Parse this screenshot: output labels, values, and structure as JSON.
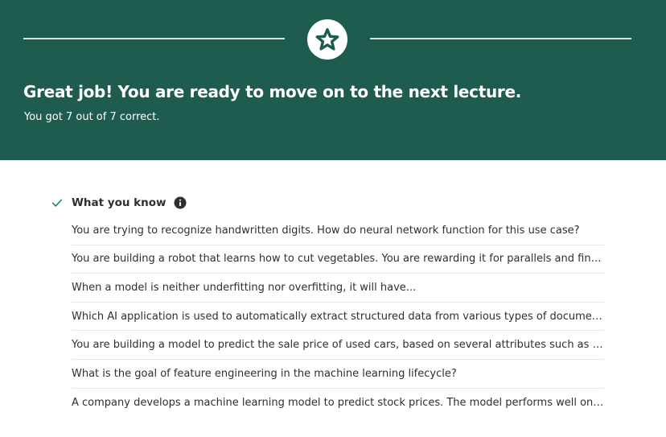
{
  "banner": {
    "headline": "Great job! You are ready to move on to the next lecture.",
    "score": "You got 7 out of 7 correct.",
    "icon": "star-icon",
    "bg_color": "#1f5c50"
  },
  "section": {
    "title": "What you know",
    "status_icon": "check-icon",
    "info_icon": "info-icon",
    "check_color": "#1e7a63"
  },
  "questions": [
    {
      "text": "You are trying to recognize handwritten digits. How do neural network function for this use case?"
    },
    {
      "text": "You are building a robot that learns how to cut vegetables. You are rewarding it for parallels and fine cuts..."
    },
    {
      "text": "When a model is neither underfitting nor overfitting, it will have..."
    },
    {
      "text": "Which AI application is used to automatically extract structured data from various types of documents..."
    },
    {
      "text": "You are building a model to predict the sale price of used cars, based on several attributes such as the..."
    },
    {
      "text": "What is the goal of feature engineering in the machine learning lifecycle?"
    },
    {
      "text": "A company develops a machine learning model to predict stock prices. The model performs well on the..."
    }
  ]
}
